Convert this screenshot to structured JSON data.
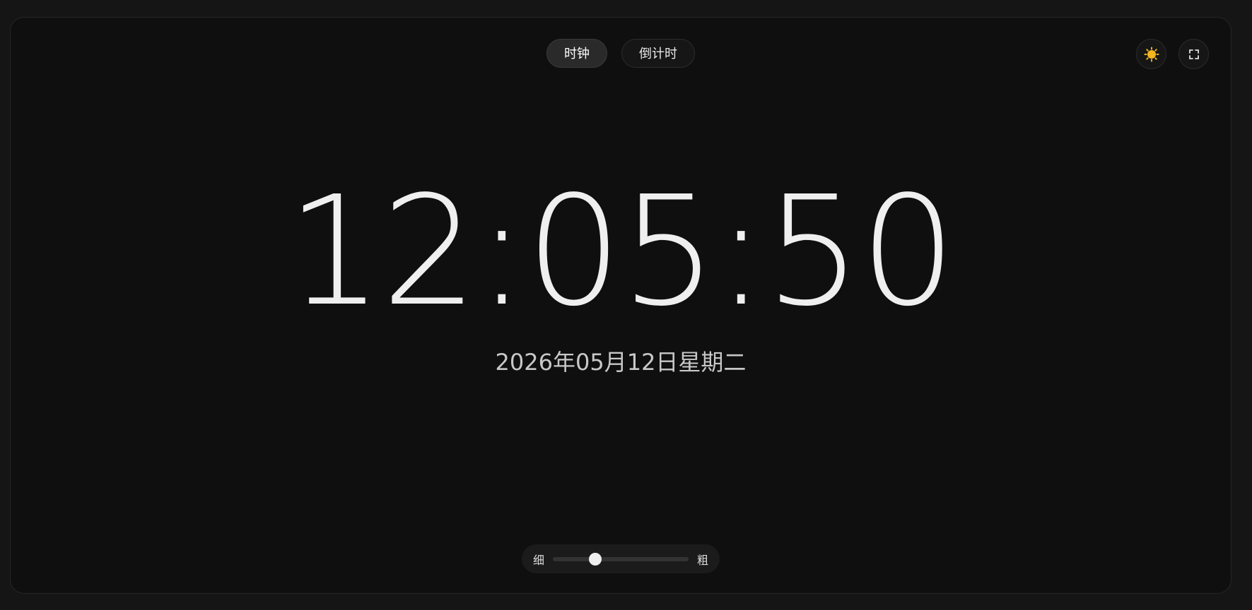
{
  "tabs": [
    {
      "label": "时钟",
      "active": true
    },
    {
      "label": "倒计时",
      "active": false
    }
  ],
  "header": {
    "theme_icon": "sun-icon",
    "fullscreen_icon": "fullscreen-icon",
    "sun_color": "#f5b51f"
  },
  "clock": {
    "time": "12:05:50",
    "date": "2026年05月12日星期二"
  },
  "font_weight": {
    "thin_label": "细",
    "bold_label": "粗",
    "level": 0.31
  },
  "colors": {
    "background": "#0f0f0f",
    "text": "#efefef"
  }
}
